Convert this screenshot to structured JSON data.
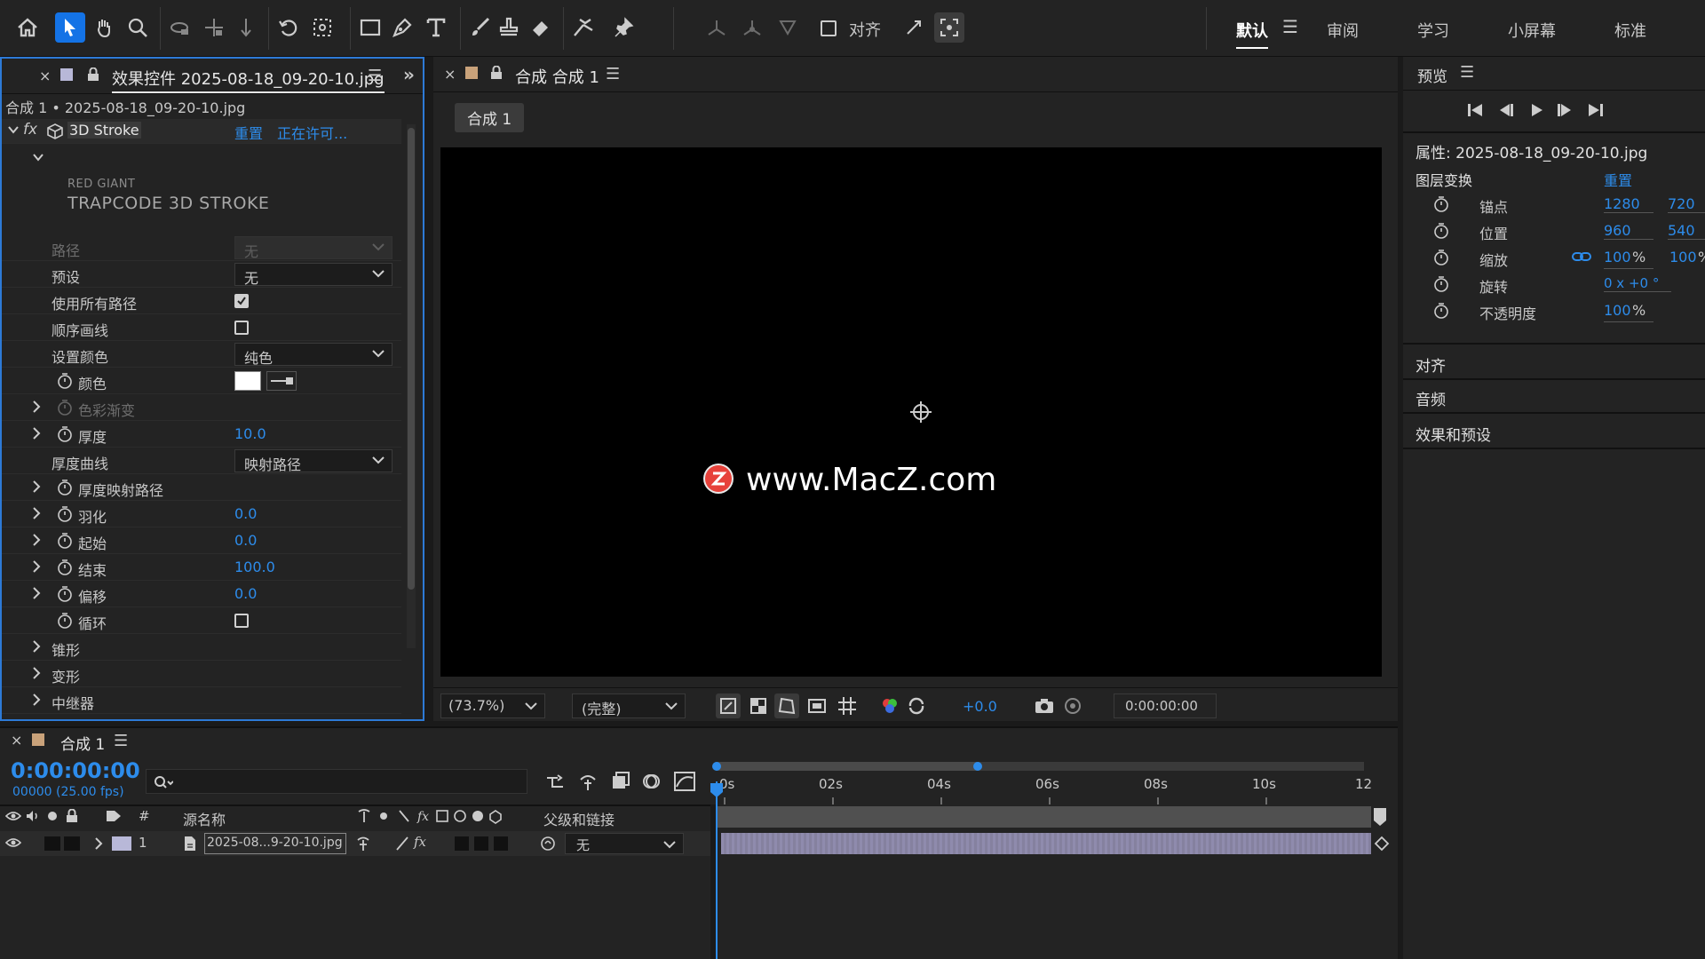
{
  "toolbar": {
    "align_label": "对齐",
    "workspaces": [
      "默认",
      "审阅",
      "学习",
      "小屏幕",
      "标准"
    ],
    "menu_glyph": "☰"
  },
  "effect_panel": {
    "tab_title": "效果控件 2025-08-18_09-20-10.jpg",
    "breadcrumb": "合成 1 • 2025-08-18_09-20-10.jpg",
    "effect_name": "3D Stroke",
    "reset_label": "重置",
    "license_label": "正在许可...",
    "brand_small": "RED GIANT",
    "brand_large": "TRAPCODE 3D STROKE",
    "path_label": "路径",
    "path_value": "无",
    "preset_label": "预设",
    "preset_value": "无",
    "use_all_paths_label": "使用所有路径",
    "stroke_sequentially_label": "顺序画线",
    "set_color_label": "设置颜色",
    "set_color_value": "纯色",
    "color_label": "颜色",
    "gradient_label": "色彩渐变",
    "thickness_label": "厚度",
    "thickness_value": "10.0",
    "thickness_curve_label": "厚度曲线",
    "thickness_curve_value": "映射路径",
    "thickness_map_label": "厚度映射路径",
    "feather_label": "羽化",
    "feather_value": "0.0",
    "start_label": "起始",
    "start_value": "0.0",
    "end_label": "结束",
    "end_value": "100.0",
    "offset_label": "偏移",
    "offset_value": "0.0",
    "loop_label": "循环",
    "taper_label": "锥形",
    "transform_label": "变形",
    "repeater_label": "中继器"
  },
  "comp": {
    "tab_title": "合成 合成 1",
    "crumb": "合成 1",
    "watermark": "www.MacZ.com",
    "zoom": "(73.7%)",
    "quality": "(完整)",
    "exposure": "+0.0",
    "timecode": "0:00:00:00"
  },
  "right_panel": {
    "preview_title": "预览",
    "props_title": "属性: 2025-08-18_09-20-10.jpg",
    "layer_transform": "图层变换",
    "reset": "重置",
    "anchor_label": "锚点",
    "anchor_x": "1280",
    "anchor_y": "720",
    "position_label": "位置",
    "position_x": "960",
    "position_y": "540",
    "scale_label": "缩放",
    "scale_x": "100",
    "scale_y": "100",
    "rotation_label": "旋转",
    "rotation_value": "0 x +0 °",
    "opacity_label": "不透明度",
    "opacity_value": "100",
    "percent": "%",
    "sections": [
      "对齐",
      "音频",
      "效果和预设"
    ]
  },
  "timeline": {
    "tab_title": "合成 1",
    "timecode": "0:00:00:00",
    "frame_info": "00000 (25.00 fps)",
    "col_hash": "#",
    "col_source": "源名称",
    "col_parent": "父级和链接",
    "ruler": [
      "0s",
      "02s",
      "04s",
      "06s",
      "08s",
      "10s",
      "12"
    ],
    "layer_index": "1",
    "layer_name": "2025-08...9-20-10.jpg",
    "layer_parent": "无",
    "fx_glyph": "fx"
  }
}
